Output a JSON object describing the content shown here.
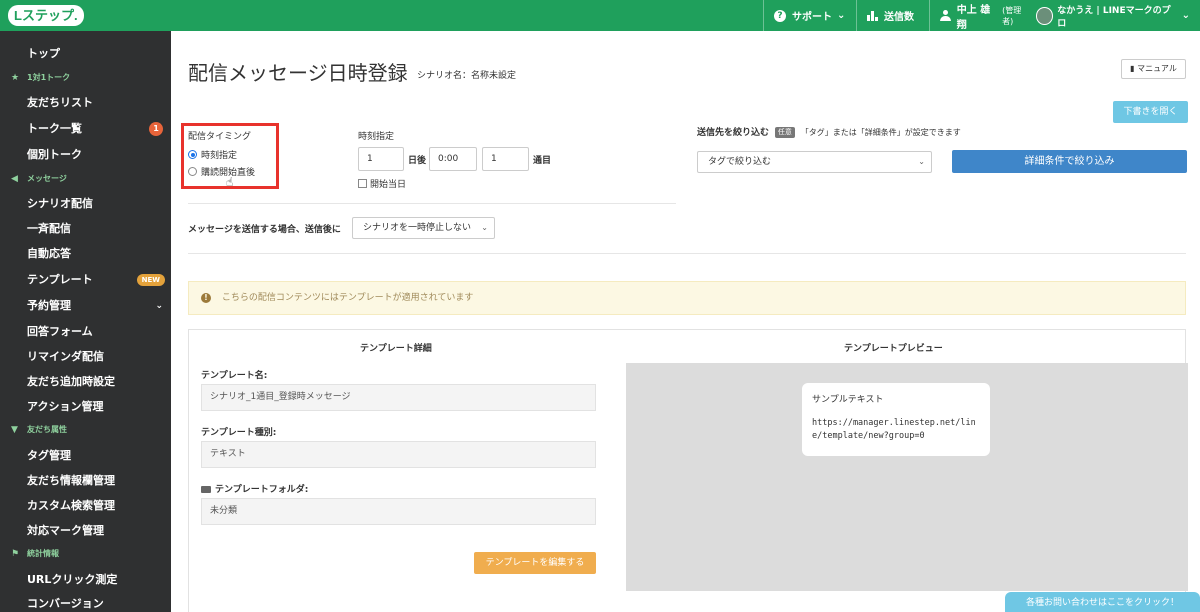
{
  "topbar": {
    "logo": "Lステップ.",
    "support": "サポート",
    "send_count": "送信数",
    "user_name": "中上 雄翔",
    "user_role": "(管理者)",
    "account": "なかうえ | LINEマークのプロ"
  },
  "sidebar": {
    "top": "トップ",
    "sec_talk": "1対1トーク",
    "friends_list": "友だちリスト",
    "talk_list": "トーク一覧",
    "talk_badge": "1",
    "individual_talk": "個別トーク",
    "sec_message": "メッセージ",
    "scenario": "シナリオ配信",
    "broadcast": "一斉配信",
    "auto_reply": "自動応答",
    "template": "テンプレート",
    "template_badge": "NEW",
    "reservation": "予約管理",
    "answer_form": "回答フォーム",
    "reminder": "リマインダ配信",
    "friend_add_setting": "友だち追加時設定",
    "action": "アクション管理",
    "sec_attr": "友だち属性",
    "tag": "タグ管理",
    "friend_info": "友だち情報欄管理",
    "custom_search": "カスタム検索管理",
    "mark": "対応マーク管理",
    "sec_stats": "統計情報",
    "url_click": "URLクリック測定",
    "conversion": "コンバージョン"
  },
  "page": {
    "title": "配信メッセージ日時登録",
    "subtitle": "シナリオ名：名称未設定",
    "manual": "マニュアル",
    "draft": "下書きを開く"
  },
  "timing": {
    "label": "配信タイミング",
    "option1": "時刻指定",
    "option2": "購読開始直後",
    "selected": "時刻指定"
  },
  "time_spec": {
    "label": "時刻指定",
    "days": "1",
    "days_unit": "日後",
    "time": "0:00",
    "count": "1",
    "count_unit": "通目",
    "start_day": "開始当日"
  },
  "after_send": {
    "label": "メッセージを送信する場合、送信後に",
    "value": "シナリオを一時停止しない"
  },
  "filter": {
    "label": "送信先を絞り込む",
    "badge": "任意",
    "hint": "「タグ」または「詳細条件」が設定できます",
    "tag_select": "タグで絞り込む",
    "detail_button": "詳細条件で絞り込み"
  },
  "alert": {
    "text": "こちらの配信コンテンツにはテンプレートが適用されています"
  },
  "template": {
    "detail_header": "テンプレート詳細",
    "preview_header": "テンプレートプレビュー",
    "name_label": "テンプレート名:",
    "name_value": "シナリオ_1通目_登録時メッセージ",
    "type_label": "テンプレート種別:",
    "type_value": "テキスト",
    "folder_label": "テンプレートフォルダ:",
    "folder_value": "未分類",
    "edit_button": "テンプレートを編集する",
    "preview_title": "サンプルテキスト",
    "preview_url": "https://manager.linestep.net/line/template/new?group=0"
  },
  "contact": {
    "label": "各種お問い合わせはここをクリック！"
  }
}
